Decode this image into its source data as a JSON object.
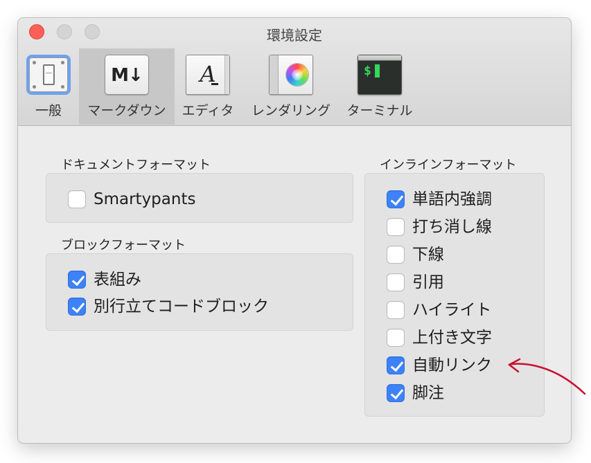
{
  "window": {
    "title": "環境設定"
  },
  "tabs": [
    {
      "label": "一般",
      "icon": "general-switch-icon",
      "selected": false
    },
    {
      "label": "マークダウン",
      "icon": "markdown-icon",
      "selected": true,
      "icon_text": "M↓"
    },
    {
      "label": "エディタ",
      "icon": "editor-icon",
      "selected": false,
      "icon_text": "A"
    },
    {
      "label": "レンダリング",
      "icon": "color-wheel-icon",
      "selected": false
    },
    {
      "label": "ターミナル",
      "icon": "terminal-icon",
      "selected": false,
      "icon_text": "$"
    }
  ],
  "document_format": {
    "title": "ドキュメントフォーマット",
    "options": [
      {
        "label": "Smartypants",
        "checked": false
      }
    ]
  },
  "block_format": {
    "title": "ブロックフォーマット",
    "options": [
      {
        "label": "表組み",
        "checked": true
      },
      {
        "label": "別行立てコードブロック",
        "checked": true
      }
    ]
  },
  "inline_format": {
    "title": "インラインフォーマット",
    "options": [
      {
        "label": "単語内強調",
        "checked": true
      },
      {
        "label": "打ち消し線",
        "checked": false
      },
      {
        "label": "下線",
        "checked": false
      },
      {
        "label": "引用",
        "checked": false
      },
      {
        "label": "ハイライト",
        "checked": false
      },
      {
        "label": "上付き文字",
        "checked": false
      },
      {
        "label": "自動リンク",
        "checked": true
      },
      {
        "label": "脚注",
        "checked": true
      }
    ]
  },
  "colors": {
    "accent": "#3d82f7",
    "annotation_arrow": "#c8102e"
  }
}
